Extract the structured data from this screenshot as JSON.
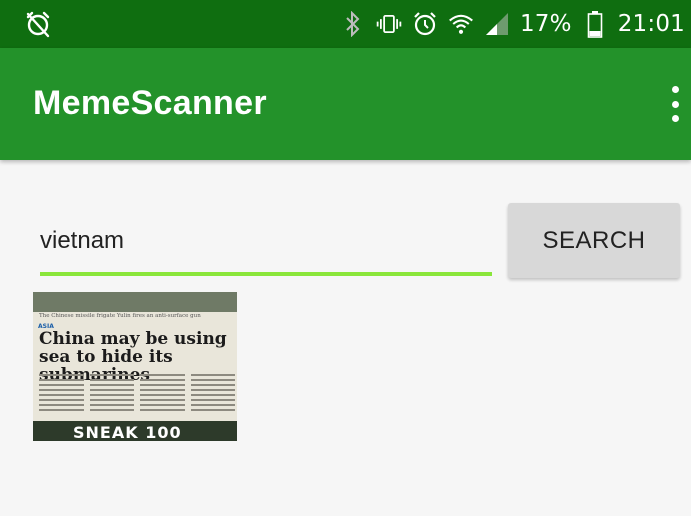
{
  "status_bar": {
    "battery_text": "17%",
    "time": "21:01",
    "icons": [
      "alarm-off-icon",
      "bluetooth-icon",
      "vibrate-icon",
      "alarm-icon",
      "wifi-icon",
      "signal-icon",
      "battery-icon"
    ]
  },
  "app_bar": {
    "title": "MemeScanner",
    "menu_icon": "overflow-menu-icon"
  },
  "search": {
    "value": "vietnam",
    "button_label": "SEARCH",
    "accent_color": "#8ae63a"
  },
  "results": [
    {
      "caption": "The Chinese missile frigate Yulin fires an anti-surface gun",
      "section": "ASIA",
      "headline": "China may be using sea to hide its submarines",
      "banner": "SNEAK 100"
    }
  ],
  "colors": {
    "status_bar": "#0f6e10",
    "app_bar": "#23922a",
    "button": "#d8d8d8"
  }
}
